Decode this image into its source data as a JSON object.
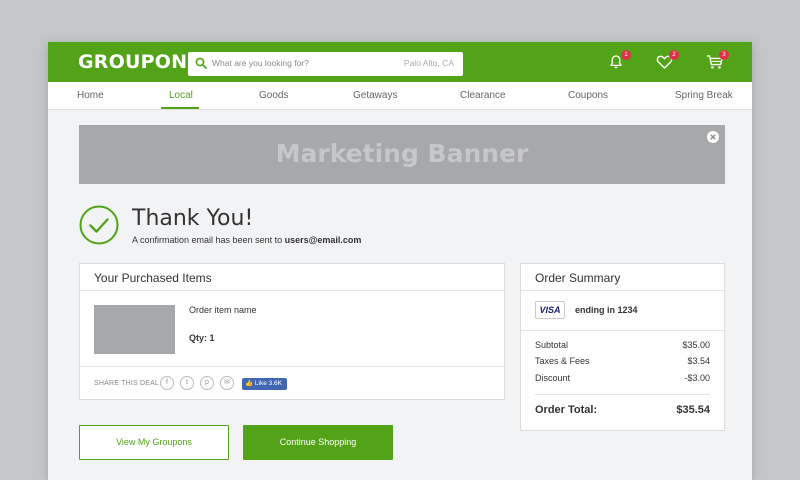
{
  "header": {
    "logo": "GROUPON",
    "search": {
      "placeholder": "What are you looking for?",
      "location": "Palo Alto, CA"
    },
    "icons": [
      {
        "name": "bell-icon",
        "badge": "1"
      },
      {
        "name": "heart-icon",
        "badge": "2"
      },
      {
        "name": "cart-icon",
        "badge": "3"
      }
    ],
    "accent_color": "#53a318",
    "badge_color": "#e0314b"
  },
  "nav": {
    "items": [
      "Home",
      "Local",
      "Goods",
      "Getaways",
      "Clearance",
      "Coupons",
      "Spring Break"
    ],
    "active": "Local"
  },
  "banner": {
    "text": "Marketing Banner"
  },
  "confirmation": {
    "title": "Thank You!",
    "message": "A confirmation email has been sent to",
    "email": "users@email.com"
  },
  "purchased": {
    "heading": "Your Purchased Items",
    "item_name": "Order item name",
    "qty": "Qty: 1",
    "share_label": "SHARE THIS DEAL",
    "share_icons": [
      "facebook-icon",
      "twitter-icon",
      "pinterest-icon",
      "email-icon"
    ],
    "like_label": "Like 3.6K"
  },
  "summary": {
    "heading": "Order Summary",
    "card_brand": "VISA",
    "card_text": "ending in 1234",
    "rows": [
      {
        "label": "Subtotal",
        "value": "$35.00"
      },
      {
        "label": "Taxes & Fees",
        "value": "$3.54"
      },
      {
        "label": "Discount",
        "value": "-$3.00"
      }
    ],
    "total_label": "Order Total:",
    "total_value": "$35.54"
  },
  "actions": {
    "view_label": "View My Groupons",
    "continue_label": "Continue Shopping"
  }
}
